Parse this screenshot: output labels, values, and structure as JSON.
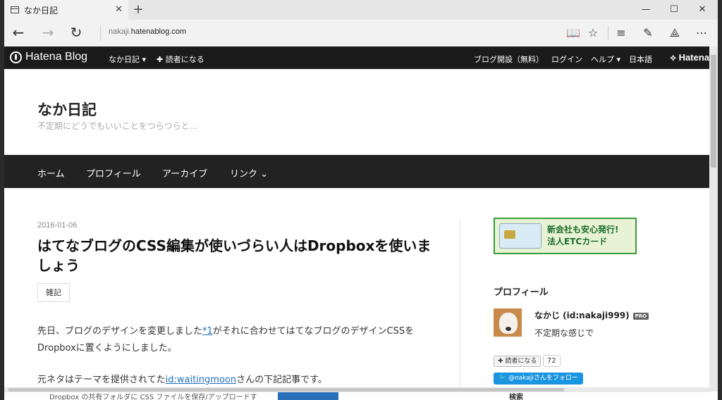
{
  "browser": {
    "tab_title": "なか日記",
    "tab_close": "✕",
    "new_tab": "+",
    "url_prefix": "nakaji.",
    "url_domain": "hatenablog.com",
    "window_controls": [
      "—",
      "☐",
      "✕"
    ]
  },
  "hatena_bar": {
    "logo": "Hatena Blog",
    "blog_menu": "なか日記 ▾",
    "subscribe": "✚ 読者になる",
    "open_blog": "ブログ開設（無料）",
    "login": "ログイン",
    "help": "ヘルプ ▾",
    "language": "日本語",
    "hatena": "Hatena"
  },
  "blog": {
    "title": "なか日記",
    "description": "不定期にどうでもいいことをつらつらと..."
  },
  "nav": {
    "home": "ホーム",
    "profile": "プロフィール",
    "archive": "アーカイブ",
    "links": "リンク ⌄"
  },
  "entry": {
    "date": "2016-01-06",
    "title": "はてなブログのCSS編集が使いづらい人はDropboxを使いましょう",
    "category": "雑記",
    "p1_a": "先日、ブログのデザインを変更しました",
    "p1_link": "*1",
    "p1_b": "がそれに合わせてはてなブログのデザインCSSをDropboxに置くようにしました。",
    "p2_a": "元ネタはテーマを提供されてた",
    "p2_link": "id:waitingmoon",
    "p2_b": "さんの下記記事です。"
  },
  "sidebar": {
    "ad_line1": "新会社も安心発行!",
    "ad_line2": "法人ETCカード",
    "profile_heading": "プロフィール",
    "profile_name": "なかじ (id:nakaji999)",
    "pro_badge": "PRO",
    "profile_desc": "不定期な感じで",
    "subscribe_button": "✚ 読者になる",
    "subscriber_count": "72",
    "twitter_follow": "🐦 @nakajiさんをフォロー",
    "search_heading": "検索"
  },
  "below_fold": {
    "text": "Dropbox の共有フォルダに CSS ファイルを保存/アップロードす"
  }
}
